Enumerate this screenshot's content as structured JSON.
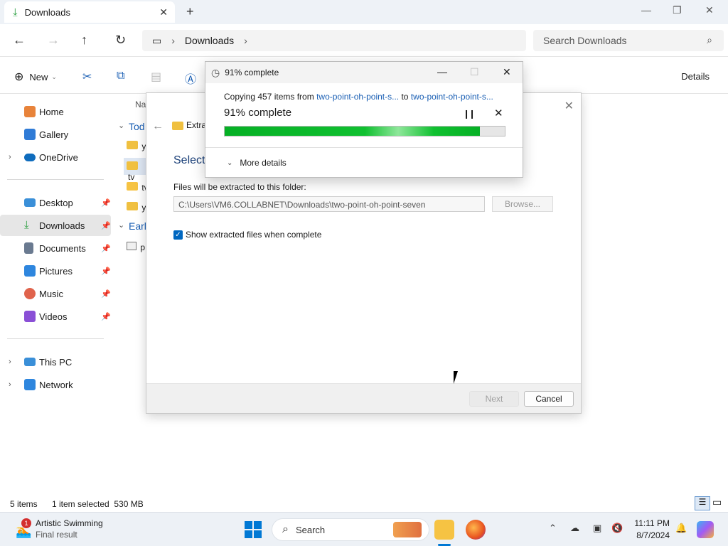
{
  "window": {
    "tab_title": "Downloads",
    "breadcrumb": [
      "Downloads"
    ],
    "search_placeholder": "Search Downloads",
    "details_label": "Details",
    "new_label": "New"
  },
  "sidebar": {
    "items": [
      {
        "label": "Home",
        "color": "#e8833a"
      },
      {
        "label": "Gallery",
        "color": "#2f7bd6"
      },
      {
        "label": "OneDrive",
        "color": "#0f6cbd"
      },
      {
        "label": "Desktop",
        "color": "#3a8fd8"
      },
      {
        "label": "Downloads",
        "color": "#2ea043"
      },
      {
        "label": "Documents",
        "color": "#6a7a90"
      },
      {
        "label": "Pictures",
        "color": "#2e86de"
      },
      {
        "label": "Music",
        "color": "#e0634c"
      },
      {
        "label": "Videos",
        "color": "#8a4fd6"
      },
      {
        "label": "This PC",
        "color": "#3a8fd8"
      },
      {
        "label": "Network",
        "color": "#2e86de"
      }
    ]
  },
  "files": {
    "name_header": "Na",
    "group_today": "Tod",
    "group_earlier": "Earl",
    "rows": [
      "yt",
      "tv",
      "tv",
      "yt",
      "p"
    ]
  },
  "status": {
    "items_count": "5 items",
    "selection": "1 item selected  530 MB"
  },
  "wizard": {
    "title": "Extra",
    "heading": "Select",
    "folder_label": "Files will be extracted to this folder:",
    "folder_path": "C:\\Users\\VM6.COLLABNET\\Downloads\\two-point-oh-point-seven",
    "browse_label": "Browse...",
    "show_files_label": "Show extracted files when complete",
    "next_label": "Next",
    "cancel_label": "Cancel"
  },
  "progress": {
    "title": "91% complete",
    "copy_prefix": "Copying 457 items from ",
    "source": "two-point-oh-point-s...",
    "to_word": " to ",
    "dest": "two-point-oh-point-s...",
    "headline": "91% complete",
    "percent": 91,
    "more_details": "More details"
  },
  "taskbar": {
    "news_title": "Artistic Swimming",
    "news_subtitle": "Final result",
    "news_badge": "1",
    "search_label": "Search",
    "time": "11:11 PM",
    "date": "8/7/2024"
  }
}
